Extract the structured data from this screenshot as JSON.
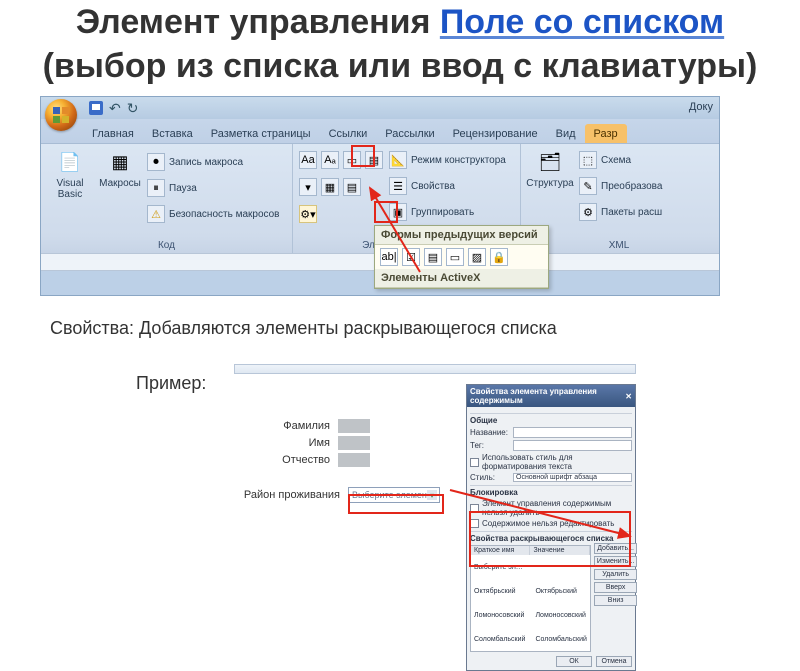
{
  "title": {
    "prefix": "Элемент управления ",
    "link": "Поле со списком",
    "suffix": " (выбор из списка или ввод с клавиатуры)"
  },
  "qat": {
    "doc_label": "Доку"
  },
  "tabs": [
    "Главная",
    "Вставка",
    "Разметка страницы",
    "Ссылки",
    "Рассылки",
    "Рецензирование",
    "Вид",
    "Разр"
  ],
  "groups": {
    "code": {
      "label": "Код",
      "vb": "Visual Basic",
      "macros": "Макросы",
      "record": "Запись макроса",
      "pause": "Пауза",
      "security": "Безопасность макросов"
    },
    "controls": {
      "label": "Элементы управле",
      "design": "Режим конструктора",
      "props": "Свойства",
      "group": "Группировать"
    },
    "xml": {
      "label": "XML",
      "structure": "Структура",
      "schema": "Схема",
      "transform": "Преобразова",
      "expand": "Пакеты расш"
    }
  },
  "dropdown": {
    "legacy": "Формы предыдущих версий",
    "activex": "Элементы ActiveX"
  },
  "text": {
    "props": "Свойства: Добавляются  элементы раскрывающегося списка",
    "example": "Пример:"
  },
  "form": {
    "surname": "Фамилия",
    "name": "Имя",
    "patronymic": "Отчество",
    "region": "Район проживания",
    "combo_placeholder": "Выберите элемент."
  },
  "panel": {
    "title": "Свойства элемента управления содержимым",
    "general": "Общие",
    "name": "Название:",
    "tag": "Тег:",
    "usestyle": "Использовать стиль для форматирования текста",
    "style": "Стиль:",
    "stylevalue": "Основной шрифт абзаца",
    "lock": "Блокировка",
    "lock1": "Элемент управления содержимым нельзя удалить",
    "lock2": "Содержимое нельзя редактировать",
    "listprops": "Свойства раскрывающегося списка",
    "col1": "Краткое имя",
    "col2": "Значение",
    "rows": [
      [
        "Выберите элемент.",
        ""
      ],
      [
        "Октябрьский",
        "Октябрьский"
      ],
      [
        "Ломоносовский",
        "Ломоносовский"
      ],
      [
        "Соломбальский",
        "Соломбальский"
      ]
    ],
    "btns": [
      "Добавить...",
      "Изменить...",
      "Удалить",
      "Вверх",
      "Вниз"
    ],
    "ok": "ОК",
    "cancel": "Отмена"
  }
}
